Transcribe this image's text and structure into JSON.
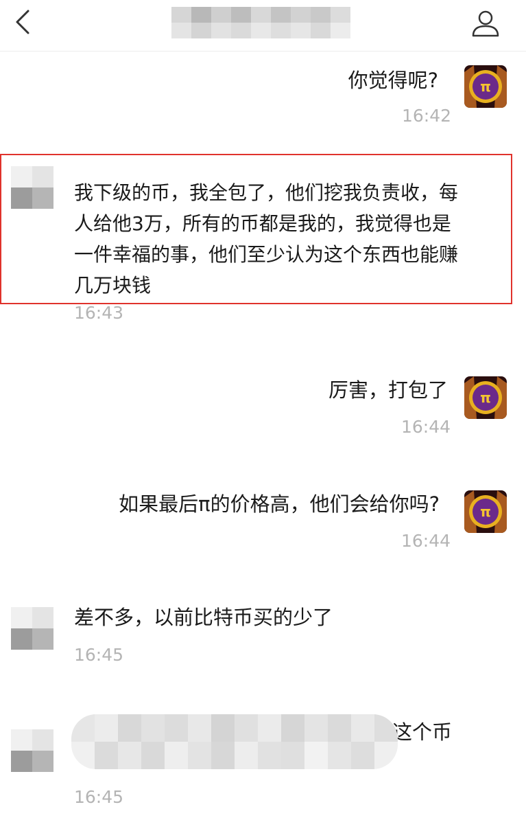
{
  "header": {
    "back_icon": "chevron-left-icon",
    "profile_icon": "person-icon"
  },
  "messages": [
    {
      "side": "right",
      "text": "你觉得呢?",
      "time": "16:42"
    },
    {
      "side": "left",
      "text": "我下级的币，我全包了，他们挖我负责收，每人给他3万，所有的币都是我的，我觉得也是一件幸福的事，他们至少认为这个东西也能赚几万块钱",
      "time": "16:43",
      "highlighted": true
    },
    {
      "side": "right",
      "text": "厉害，打包了",
      "time": "16:44"
    },
    {
      "side": "right",
      "text": "如果最后π的价格高，他们会给你吗?",
      "time": "16:44"
    },
    {
      "side": "left",
      "text": "差不多，以前比特币买的少了",
      "time": "16:45"
    },
    {
      "side": "left",
      "text_visible_fragment": "这个币",
      "time": "16:45"
    }
  ],
  "colors": {
    "highlight_border": "#e0322c",
    "timestamp": "#b4b4b4",
    "pi_avatar_ring": "#e8b020",
    "pi_avatar_center": "#6b2a8a"
  }
}
